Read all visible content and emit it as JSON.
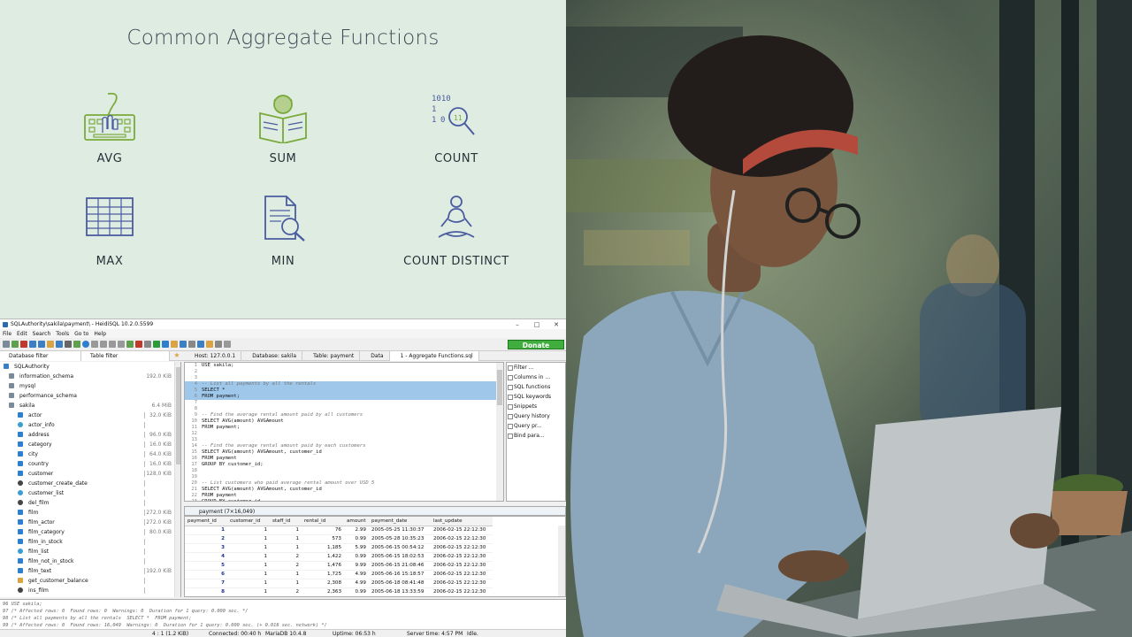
{
  "slide": {
    "title": "Common Aggregate Functions",
    "functions": [
      "AVG",
      "SUM",
      "COUNT",
      "MAX",
      "MIN",
      "COUNT DISTINCT"
    ],
    "accent_color": "#7aaa3c",
    "dark_color": "#4a5ca0"
  },
  "window": {
    "title": "SQLAuthority\\sakila\\payment\\ - HeidiSQL 10.2.0.5599",
    "controls": [
      "–",
      "□",
      "✕"
    ],
    "menu": [
      "File",
      "Edit",
      "Search",
      "Tools",
      "Go to",
      "Help"
    ],
    "donate": "Donate"
  },
  "filters": {
    "database": "Database filter",
    "table": "Table filter"
  },
  "tabs": [
    "Host: 127.0.0.1",
    "Database: sakila",
    "Table: payment",
    "Data",
    "1 - Aggregate Functions.sql"
  ],
  "tree": [
    {
      "label": "SQLAuthority",
      "size": "",
      "level": 0,
      "icon": "server-icon"
    },
    {
      "label": "information_schema",
      "size": "192.0 KiB",
      "level": 1,
      "icon": "database-icon"
    },
    {
      "label": "mysql",
      "size": "",
      "level": 1,
      "icon": "database-icon"
    },
    {
      "label": "performance_schema",
      "size": "",
      "level": 1,
      "icon": "database-icon"
    },
    {
      "label": "sakila",
      "size": "6.4 MiB",
      "level": 1,
      "icon": "database-icon"
    },
    {
      "label": "actor",
      "size": "32.0 KiB",
      "level": 2,
      "icon": "table-icon"
    },
    {
      "label": "actor_info",
      "size": "",
      "level": 2,
      "icon": "view-icon"
    },
    {
      "label": "address",
      "size": "96.0 KiB",
      "level": 2,
      "icon": "table-icon"
    },
    {
      "label": "category",
      "size": "16.0 KiB",
      "level": 2,
      "icon": "table-icon"
    },
    {
      "label": "city",
      "size": "64.0 KiB",
      "level": 2,
      "icon": "table-icon"
    },
    {
      "label": "country",
      "size": "16.0 KiB",
      "level": 2,
      "icon": "table-icon"
    },
    {
      "label": "customer",
      "size": "128.0 KiB",
      "level": 2,
      "icon": "table-icon"
    },
    {
      "label": "customer_create_date",
      "size": "",
      "level": 2,
      "icon": "trigger-icon"
    },
    {
      "label": "customer_list",
      "size": "",
      "level": 2,
      "icon": "view-icon"
    },
    {
      "label": "del_film",
      "size": "",
      "level": 2,
      "icon": "trigger-icon"
    },
    {
      "label": "film",
      "size": "272.0 KiB",
      "level": 2,
      "icon": "table-icon"
    },
    {
      "label": "film_actor",
      "size": "272.0 KiB",
      "level": 2,
      "icon": "table-icon"
    },
    {
      "label": "film_category",
      "size": "80.0 KiB",
      "level": 2,
      "icon": "table-icon"
    },
    {
      "label": "film_in_stock",
      "size": "",
      "level": 2,
      "icon": "procedure-icon"
    },
    {
      "label": "film_list",
      "size": "",
      "level": 2,
      "icon": "view-icon"
    },
    {
      "label": "film_not_in_stock",
      "size": "",
      "level": 2,
      "icon": "procedure-icon"
    },
    {
      "label": "film_text",
      "size": "192.0 KiB",
      "level": 2,
      "icon": "table-icon"
    },
    {
      "label": "get_customer_balance",
      "size": "",
      "level": 2,
      "icon": "function-icon"
    },
    {
      "label": "ins_film",
      "size": "",
      "level": 2,
      "icon": "trigger-icon"
    }
  ],
  "editor_lines": [
    {
      "n": "1",
      "t": "USE sakila;",
      "k": "code"
    },
    {
      "n": "2",
      "t": "",
      "k": "code"
    },
    {
      "n": "3",
      "t": "",
      "k": "code"
    },
    {
      "n": "4",
      "t": "-- List all payments by all the rentals",
      "k": "comment-hl"
    },
    {
      "n": "5",
      "t": "SELECT *",
      "k": "code-hl"
    },
    {
      "n": "6",
      "t": "FROM payment;",
      "k": "code-hl"
    },
    {
      "n": "7",
      "t": "",
      "k": "code"
    },
    {
      "n": "8",
      "t": "",
      "k": "code"
    },
    {
      "n": "9",
      "t": "-- Find the average rental amount paid by all customers",
      "k": "comment"
    },
    {
      "n": "10",
      "t": "SELECT AVG(amount) AVGAmount",
      "k": "code"
    },
    {
      "n": "11",
      "t": "FROM payment;",
      "k": "code"
    },
    {
      "n": "12",
      "t": "",
      "k": "code"
    },
    {
      "n": "13",
      "t": "",
      "k": "code"
    },
    {
      "n": "14",
      "t": "-- Find the average rental amount paid by each customers",
      "k": "comment"
    },
    {
      "n": "15",
      "t": "SELECT AVG(amount) AVGAmount, customer_id",
      "k": "code"
    },
    {
      "n": "16",
      "t": "FROM payment",
      "k": "code"
    },
    {
      "n": "17",
      "t": "GROUP BY customer_id;",
      "k": "code"
    },
    {
      "n": "18",
      "t": "",
      "k": "code"
    },
    {
      "n": "19",
      "t": "",
      "k": "code"
    },
    {
      "n": "20",
      "t": "-- List customers who paid average rental amount over USD 5",
      "k": "comment"
    },
    {
      "n": "21",
      "t": "SELECT AVG(amount) AVGAmount, customer_id",
      "k": "code"
    },
    {
      "n": "22",
      "t": "FROM payment",
      "k": "code"
    },
    {
      "n": "23",
      "t": "GROUP BY customer_id",
      "k": "code"
    }
  ],
  "helpers": [
    "Filter ...",
    "Columns in ...",
    "SQL functions",
    "SQL keywords",
    "Snippets",
    "Query history",
    "Query pr...",
    "Bind para..."
  ],
  "grid": {
    "title": "payment (7×16,049)",
    "columns": [
      "payment_id",
      "customer_id",
      "staff_id",
      "rental_id",
      "amount",
      "payment_date",
      "last_update"
    ],
    "rows": [
      [
        "1",
        "1",
        "1",
        "76",
        "2.99",
        "2005-05-25 11:30:37",
        "2006-02-15 22:12:30"
      ],
      [
        "2",
        "1",
        "1",
        "573",
        "0.99",
        "2005-05-28 10:35:23",
        "2006-02-15 22:12:30"
      ],
      [
        "3",
        "1",
        "1",
        "1,185",
        "5.99",
        "2005-06-15 00:54:12",
        "2006-02-15 22:12:30"
      ],
      [
        "4",
        "1",
        "2",
        "1,422",
        "0.99",
        "2005-06-15 18:02:53",
        "2006-02-15 22:12:30"
      ],
      [
        "5",
        "1",
        "2",
        "1,476",
        "9.99",
        "2005-06-15 21:08:46",
        "2006-02-15 22:12:30"
      ],
      [
        "6",
        "1",
        "1",
        "1,725",
        "4.99",
        "2005-06-16 15:18:57",
        "2006-02-15 22:12:30"
      ],
      [
        "7",
        "1",
        "1",
        "2,308",
        "4.99",
        "2005-06-18 08:41:48",
        "2006-02-15 22:12:30"
      ],
      [
        "8",
        "1",
        "2",
        "2,363",
        "0.99",
        "2005-06-18 13:33:59",
        "2006-02-15 22:12:30"
      ]
    ]
  },
  "log": [
    "96 USE sakila;",
    "97 /* Affected rows: 0  Found rows: 0  Warnings: 0  Duration for 1 query: 0.000 sec. */",
    "98 /* List all payments by all the rentals  SELECT *  FROM payment;",
    "99 /* Affected rows: 0  Found rows: 16,049  Warnings: 0  Duration for 1 query: 0.000 sec. (+ 0.016 sec. network) */"
  ],
  "status": [
    "4 : 1 (1.2 KiB)",
    "Connected: 00:40 h",
    "MariaDB 10.4.8",
    "Uptime: 06:53 h",
    "Server time: 4:57 PM",
    "Idle."
  ]
}
